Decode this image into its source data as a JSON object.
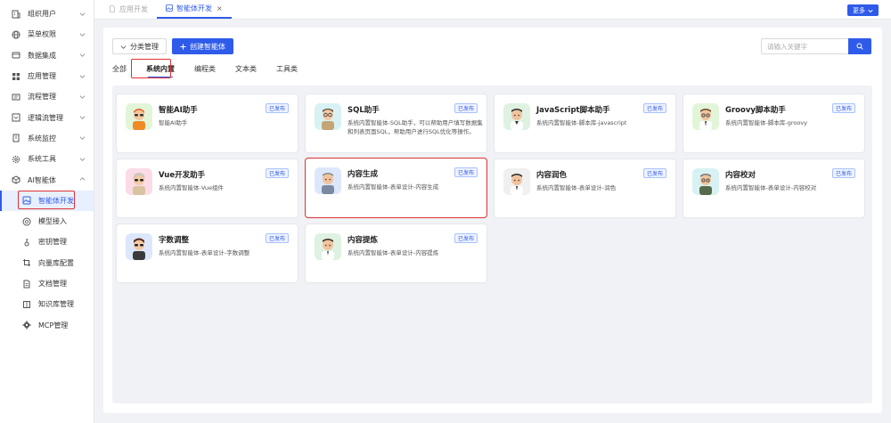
{
  "sidebar": {
    "items": [
      {
        "label": "组织用户",
        "icon": "building-icon"
      },
      {
        "label": "菜单权限",
        "icon": "globe-icon"
      },
      {
        "label": "数据集成",
        "icon": "database-icon"
      },
      {
        "label": "应用管理",
        "icon": "grid-icon"
      },
      {
        "label": "流程管理",
        "icon": "flow-icon"
      },
      {
        "label": "逻辑流管理",
        "icon": "logic-icon"
      },
      {
        "label": "系统监控",
        "icon": "monitor-icon"
      },
      {
        "label": "系统工具",
        "icon": "gear-icon"
      },
      {
        "label": "AI智能体",
        "icon": "ai-icon"
      }
    ],
    "submenu": [
      {
        "label": "智能体开发",
        "icon": "image-icon",
        "active": true
      },
      {
        "label": "模型接入",
        "icon": "model-icon"
      },
      {
        "label": "密钥管理",
        "icon": "key-icon"
      },
      {
        "label": "向量库配置",
        "icon": "crop-icon"
      },
      {
        "label": "文档管理",
        "icon": "document-icon"
      },
      {
        "label": "知识库管理",
        "icon": "book-icon"
      },
      {
        "label": "MCP管理",
        "icon": "settings-icon"
      }
    ]
  },
  "topbar": {
    "tabs": [
      {
        "label": "应用开发",
        "active": false
      },
      {
        "label": "智能体开发",
        "active": true
      }
    ],
    "close_label": "×",
    "more_label": "更多"
  },
  "toolbar": {
    "category_label": "分类管理",
    "create_label": "创建智能体",
    "search_placeholder": "请输入关键字"
  },
  "category_tabs": [
    "全部",
    "系统内置",
    "编程类",
    "文本类",
    "工具类"
  ],
  "active_category": "系统内置",
  "colors": {
    "accent": "#2f5bea",
    "highlight": "#e03131"
  },
  "cards": [
    {
      "title": "智能AI助手",
      "desc": "智能AI助手",
      "status": "已发布"
    },
    {
      "title": "SQL助手",
      "desc": "系统内置智能体-SQL助手，可以帮助用户填写数据集和列表页面SQL，帮助用户进行SQL优化等操作。",
      "status": "已发布"
    },
    {
      "title": "JavaScript脚本助手",
      "desc": "系统内置智能体-脚本库-javascript",
      "status": "已发布"
    },
    {
      "title": "Groovy脚本助手",
      "desc": "系统内置智能体-脚本库-groovy",
      "status": "已发布"
    },
    {
      "title": "Vue开发助手",
      "desc": "系统内置智能体-Vue组件",
      "status": "已发布"
    },
    {
      "title": "内容生成",
      "desc": "系统内置智能体-表单设计-内容生成",
      "status": "已发布"
    },
    {
      "title": "内容润色",
      "desc": "系统内置智能体-表单设计-润色",
      "status": "已发布"
    },
    {
      "title": "内容校对",
      "desc": "系统内置智能体-表单设计-内容校对",
      "status": "已发布"
    },
    {
      "title": "字数调整",
      "desc": "系统内置智能体-表单设计-字数调整",
      "status": "已发布"
    },
    {
      "title": "内容提炼",
      "desc": "系统内置智能体-表单设计-内容提炼",
      "status": "已发布"
    }
  ]
}
